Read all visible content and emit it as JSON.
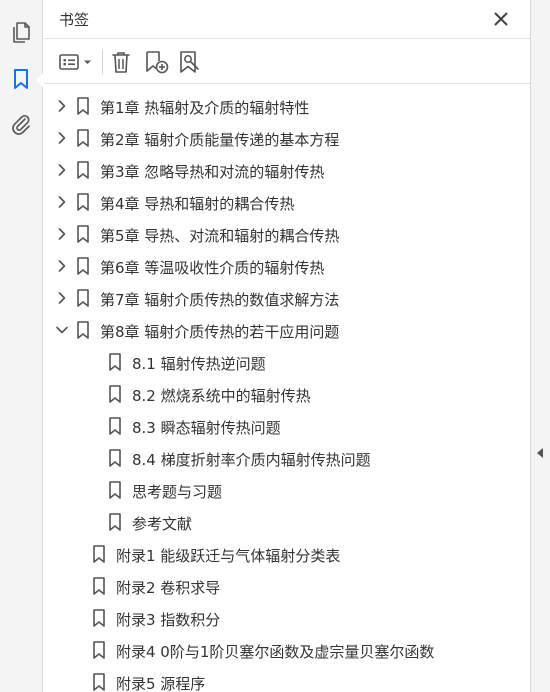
{
  "rail": {
    "items": [
      {
        "name": "pages-icon"
      },
      {
        "name": "bookmarks-icon",
        "active": true
      },
      {
        "name": "attachments-icon"
      }
    ],
    "accent": "#1473e6"
  },
  "panel": {
    "title": "书签",
    "close_icon": "close-icon"
  },
  "toolbar": {
    "items": [
      "options-menu-icon",
      "delete-bookmark-icon",
      "new-bookmark-icon",
      "bookmark-from-structure-icon"
    ]
  },
  "bookmarks": [
    {
      "label": "第1章  热辐射及介质的辐射特性",
      "level": 0,
      "state": "collapsed"
    },
    {
      "label": "第2章  辐射介质能量传递的基本方程",
      "level": 0,
      "state": "collapsed"
    },
    {
      "label": "第3章  忽略导热和对流的辐射传热",
      "level": 0,
      "state": "collapsed"
    },
    {
      "label": "第4章  导热和辐射的耦合传热",
      "level": 0,
      "state": "collapsed"
    },
    {
      "label": "第5章  导热、对流和辐射的耦合传热",
      "level": 0,
      "state": "collapsed"
    },
    {
      "label": "第6章  等温吸收性介质的辐射传热",
      "level": 0,
      "state": "collapsed"
    },
    {
      "label": "第7章  辐射介质传热的数值求解方法",
      "level": 0,
      "state": "collapsed"
    },
    {
      "label": "第8章  辐射介质传热的若干应用问题",
      "level": 0,
      "state": "expanded"
    },
    {
      "label": "8.1  辐射传热逆问题",
      "level": 1,
      "state": "leaf"
    },
    {
      "label": "8.2  燃烧系统中的辐射传热",
      "level": 1,
      "state": "leaf"
    },
    {
      "label": "8.3  瞬态辐射传热问题",
      "level": 1,
      "state": "leaf"
    },
    {
      "label": "8.4  梯度折射率介质内辐射传热问题",
      "level": 1,
      "state": "leaf"
    },
    {
      "label": "思考题与习题",
      "level": 1,
      "state": "leaf"
    },
    {
      "label": "参考文献",
      "level": 1,
      "state": "leaf"
    },
    {
      "label": "附录1  能级跃迁与气体辐射分类表",
      "level": 0,
      "state": "leaf"
    },
    {
      "label": "附录2  卷积求导",
      "level": 0,
      "state": "leaf"
    },
    {
      "label": "附录3  指数积分",
      "level": 0,
      "state": "leaf"
    },
    {
      "label": "附录4  0阶与1阶贝塞尔函数及虚宗量贝塞尔函数",
      "level": 0,
      "state": "leaf"
    },
    {
      "label": "附录5  源程序",
      "level": 0,
      "state": "leaf"
    }
  ]
}
